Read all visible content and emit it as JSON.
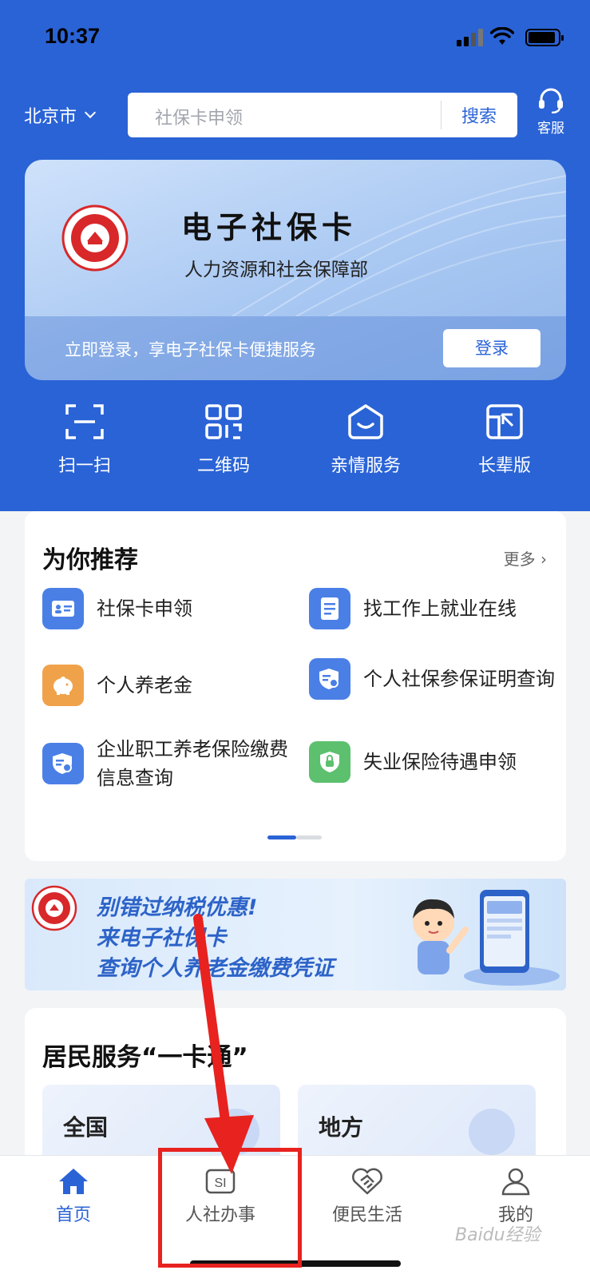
{
  "status_bar": {
    "time": "10:37"
  },
  "header": {
    "city": "北京市",
    "search_placeholder": "社保卡申领",
    "search_button": "搜索",
    "customer_service": "客服"
  },
  "card": {
    "title": "电子社保卡",
    "subtitle": "人力资源和社会保障部",
    "login_prompt": "立即登录，享电子社保卡便捷服务",
    "login_button": "登录"
  },
  "quick_actions": [
    {
      "label": "扫一扫",
      "icon": "scan-icon"
    },
    {
      "label": "二维码",
      "icon": "qrcode-icon"
    },
    {
      "label": "亲情服务",
      "icon": "family-service-icon"
    },
    {
      "label": "长辈版",
      "icon": "elder-mode-icon"
    }
  ],
  "recommend": {
    "title": "为你推荐",
    "more": "更多",
    "items": [
      {
        "label": "社保卡申领",
        "icon": "id-card-icon",
        "color": "#4a7fe6"
      },
      {
        "label": "找工作上就业在线",
        "icon": "document-icon",
        "color": "#4a7fe6"
      },
      {
        "label": "个人养老金",
        "icon": "piggy-bank-icon",
        "color": "#f0a24a"
      },
      {
        "label": "个人社保参保证明查询",
        "icon": "shield-search-icon",
        "color": "#4a7fe6"
      },
      {
        "label": "企业职工养老保险缴费信息查询",
        "icon": "shield-search-icon",
        "color": "#4a7fe6"
      },
      {
        "label": "失业保险待遇申领",
        "icon": "shield-lock-icon",
        "color": "#5cc06e"
      }
    ]
  },
  "banner": {
    "line1": "别错过纳税优惠!",
    "line2": "来电子社保卡",
    "line3": "查询个人养老金缴费凭证"
  },
  "resident_service": {
    "title": "居民服务“一卡通”",
    "tiles": [
      "全国",
      "地方"
    ]
  },
  "tabbar": {
    "tabs": [
      {
        "label": "首页",
        "icon": "home-icon",
        "active": true
      },
      {
        "label": "人社办事",
        "icon": "si-icon",
        "active": false
      },
      {
        "label": "便民生活",
        "icon": "handshake-icon",
        "active": false
      },
      {
        "label": "我的",
        "icon": "user-icon",
        "active": false
      }
    ]
  },
  "colors": {
    "brand_blue": "#2a63d6",
    "annotation_red": "#e8221f"
  },
  "watermark": "Baidu经验"
}
